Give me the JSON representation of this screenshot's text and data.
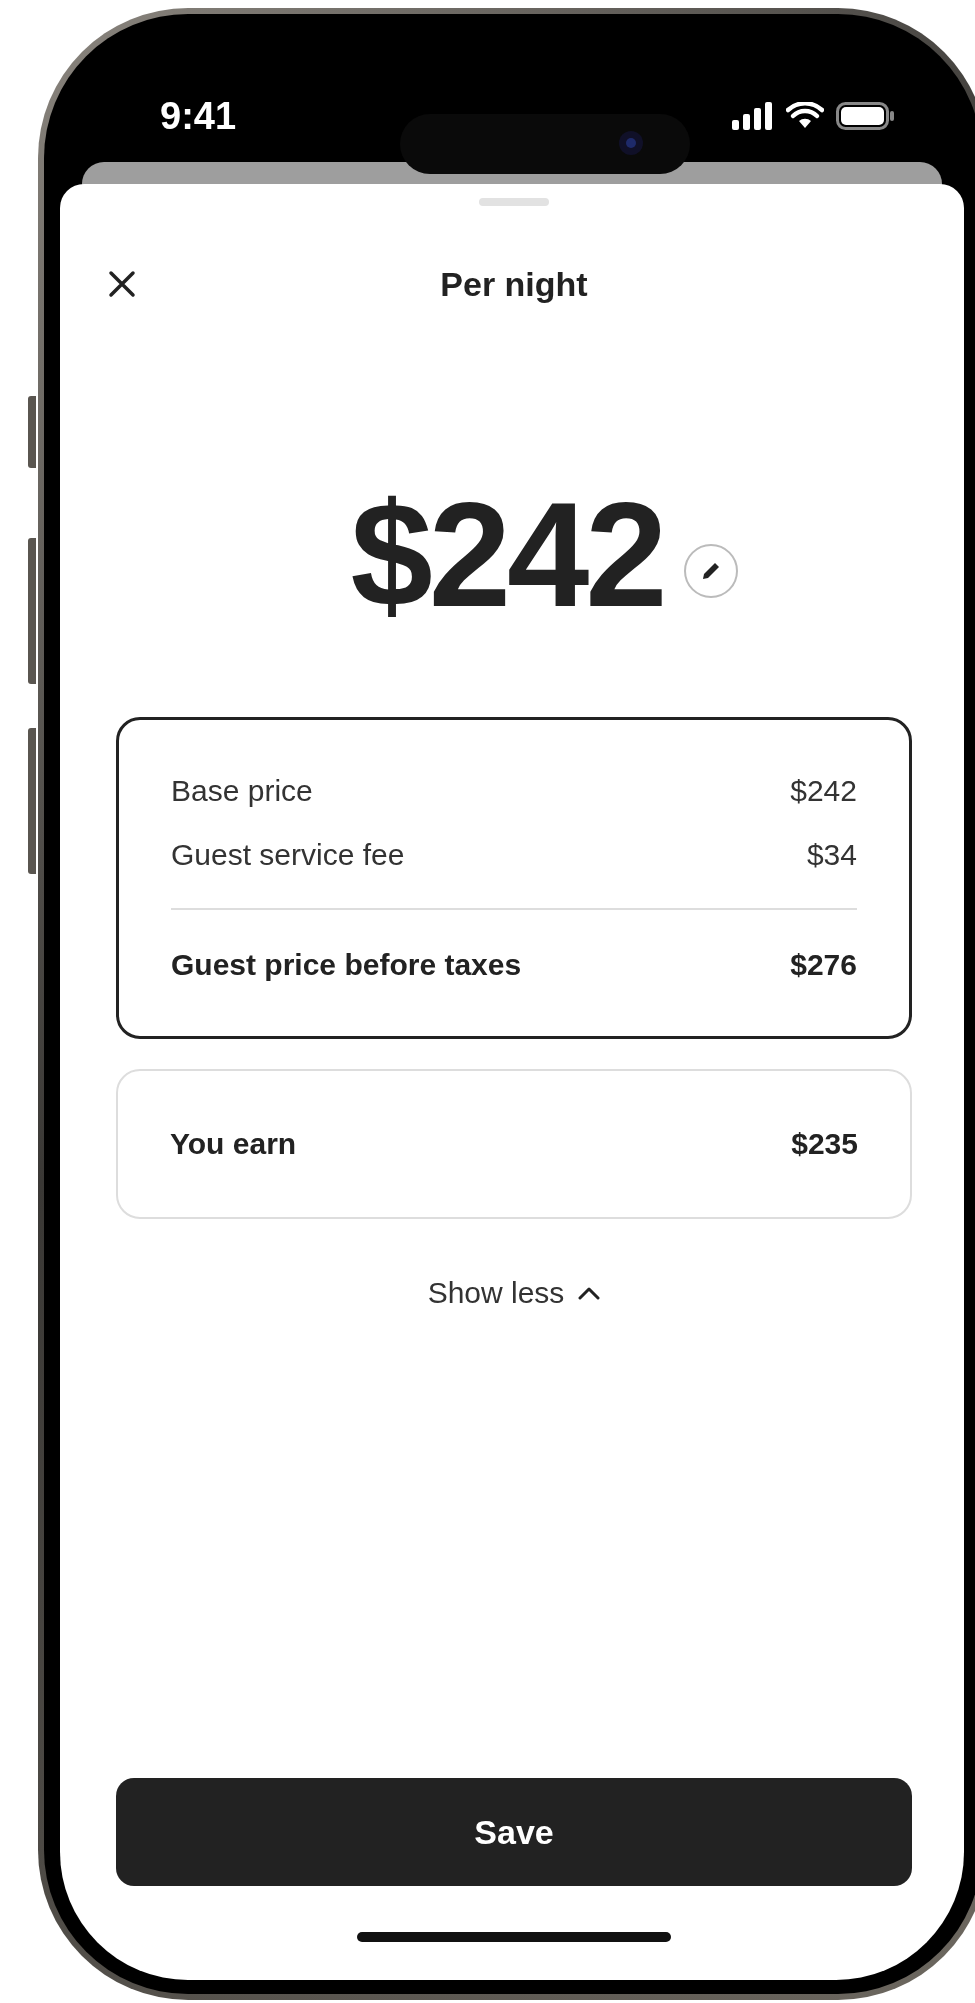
{
  "status_bar": {
    "time": "9:41"
  },
  "sheet": {
    "title": "Per night",
    "price": "$242"
  },
  "breakdown": {
    "rows": [
      {
        "label": "Base price",
        "value": "$242",
        "kind": "line"
      },
      {
        "label": "Guest service fee",
        "value": "$34",
        "kind": "line"
      },
      {
        "label": "Guest price before taxes",
        "value": "$276",
        "kind": "total"
      }
    ]
  },
  "earnings": {
    "label": "You earn",
    "value": "$235"
  },
  "toggle": {
    "label": "Show less",
    "expanded": true
  },
  "save_button": {
    "label": "Save"
  }
}
